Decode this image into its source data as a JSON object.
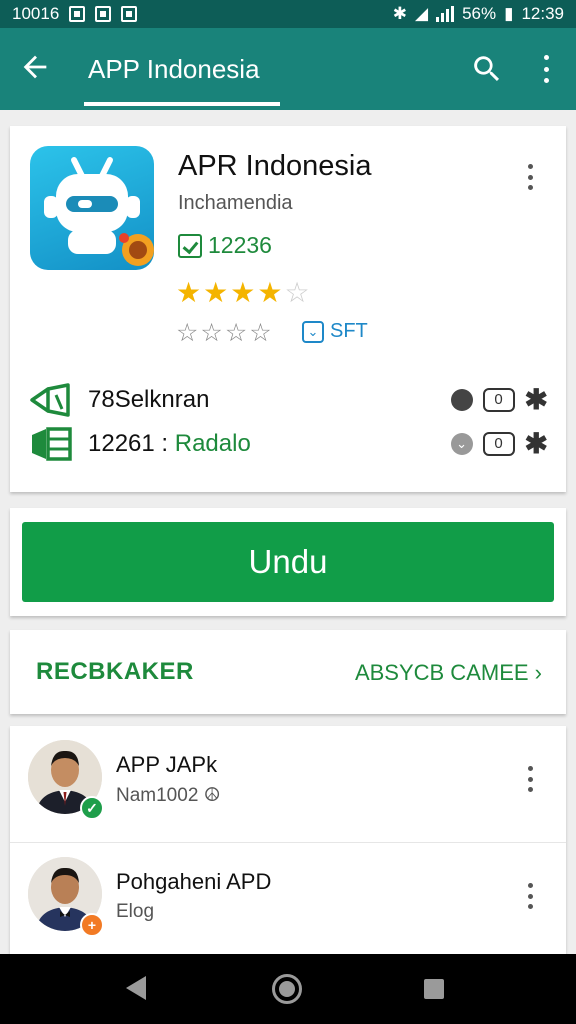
{
  "status_bar": {
    "left_text": "10016",
    "battery": "56%",
    "time": "12:39"
  },
  "app_bar": {
    "title": "APP Indonesia",
    "back_icon": "arrow-left-icon",
    "search_icon": "search-icon",
    "more_icon": "more-vert-icon"
  },
  "app_info": {
    "name": "APR Indonesia",
    "developer": "Inchamendia",
    "download_count": "12236",
    "rating_stars": 4,
    "rating_max": 5,
    "badge_label": "SFT",
    "stats": [
      {
        "number": "78",
        "label": "Selknran",
        "label_colored": ""
      },
      {
        "number": "12261 :",
        "label": "",
        "label_colored": "Radalo"
      }
    ],
    "zero_label": "0"
  },
  "install_button": {
    "label": "Undu",
    "color": "#119d48"
  },
  "recommendations": {
    "title": "RECBKAKER",
    "link": "ABSYCB CAMEE"
  },
  "list": [
    {
      "name": "APP JAPk",
      "subtitle": "Nam1002",
      "badge_color": "#1e9e4a",
      "badge_icon": "check-icon"
    },
    {
      "name": "Pohgaheni APD",
      "subtitle": "Elog",
      "badge_color": "#f27a24",
      "badge_icon": "plus-icon"
    }
  ],
  "colors": {
    "status_bar": "#0d5d57",
    "app_bar": "#19837a",
    "accent_green": "#1e8a3c",
    "star_gold": "#f4b400"
  }
}
